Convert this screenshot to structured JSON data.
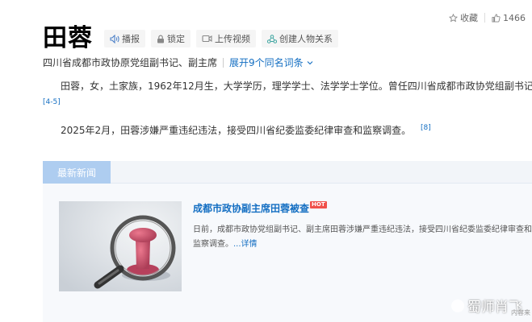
{
  "top_actions": {
    "favorite_label": "收藏",
    "count": "1466"
  },
  "title": "田蓉",
  "toolbar": {
    "broadcast": "播报",
    "lock": "锁定",
    "upload_video": "上传视频",
    "relationship": "创建人物关系"
  },
  "subtitle": {
    "desc": "四川省成都市政协原党组副书记、副主席",
    "expand": "展开9个同名词条"
  },
  "summary": {
    "line1": "田蓉，女，土家族，1962年12月生，大学学历，理学学士、法学学士学位。曾任四川省成都市政协党组副书记、",
    "ref1": "[4-5]",
    "para2": "2025年2月，田蓉涉嫌严重违纪违法，接受四川省纪委监委纪律审查和监察调查。",
    "ref2": "[8]"
  },
  "news": {
    "tab": "最新新闻",
    "title": "成都市政协副主席田蓉被查",
    "badge": "HOT",
    "text": "日前，成都市政协党组副书记、副主席田蓉涉嫌严重违纪违法，接受四川省纪委监委纪律审查和监察调查。",
    "more": "...详情",
    "source": "内容来"
  },
  "watermark": "蜀师肖飞"
}
